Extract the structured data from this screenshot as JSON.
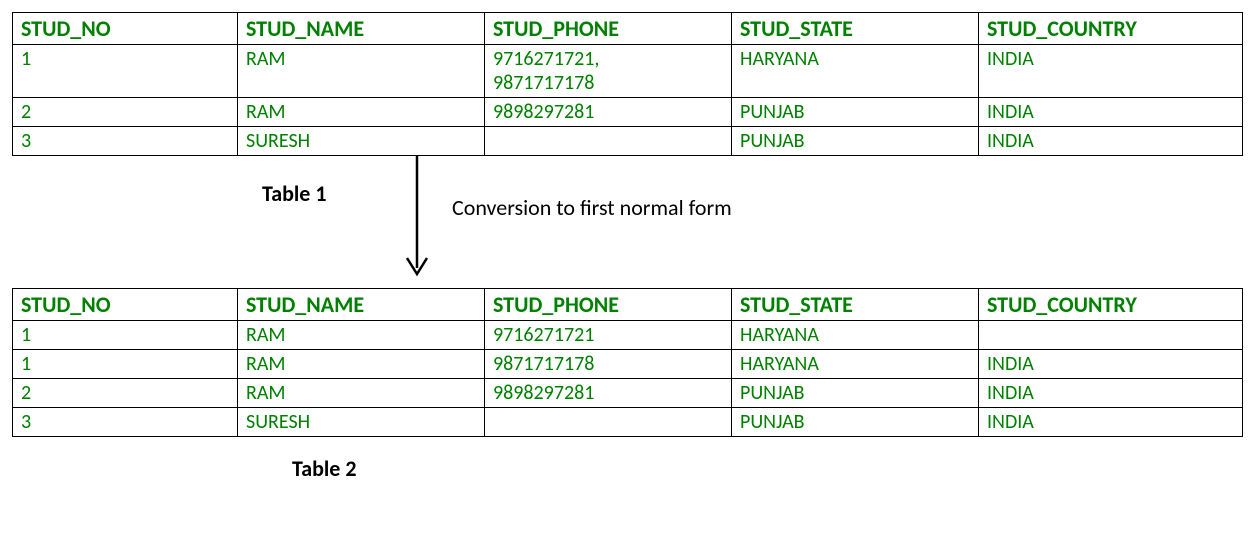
{
  "table1": {
    "headers": [
      "STUD_NO",
      "STUD_NAME",
      "STUD_PHONE",
      "STUD_STATE",
      "STUD_COUNTRY"
    ],
    "rows": [
      [
        "1",
        "RAM",
        "9716271721,\n9871717178",
        "HARYANA",
        "INDIA"
      ],
      [
        "2",
        "RAM",
        "9898297281",
        "PUNJAB",
        "INDIA"
      ],
      [
        "3",
        "SURESH",
        "",
        "PUNJAB",
        "INDIA"
      ]
    ],
    "caption": "Table 1"
  },
  "conversion_label": "Conversion to first normal form",
  "table2": {
    "headers": [
      "STUD_NO",
      "STUD_NAME",
      "STUD_PHONE",
      "STUD_STATE",
      "STUD_COUNTRY"
    ],
    "rows": [
      [
        "1",
        "RAM",
        "9716271721",
        "HARYANA",
        ""
      ],
      [
        "1",
        "RAM",
        "9871717178",
        "HARYANA",
        "INDIA"
      ],
      [
        "2",
        "RAM",
        "9898297281",
        "PUNJAB",
        "INDIA"
      ],
      [
        "3",
        "SURESH",
        "",
        "PUNJAB",
        "INDIA"
      ]
    ],
    "caption": "Table 2"
  },
  "chart_data": {
    "type": "table",
    "description": "Diagram showing conversion of a relation into First Normal Form (1NF) by splitting a multi-valued attribute (STUD_PHONE) into separate rows.",
    "before": {
      "name": "Table 1",
      "columns": [
        "STUD_NO",
        "STUD_NAME",
        "STUD_PHONE",
        "STUD_STATE",
        "STUD_COUNTRY"
      ],
      "rows": [
        {
          "STUD_NO": "1",
          "STUD_NAME": "RAM",
          "STUD_PHONE": "9716271721, 9871717178",
          "STUD_STATE": "HARYANA",
          "STUD_COUNTRY": "INDIA"
        },
        {
          "STUD_NO": "2",
          "STUD_NAME": "RAM",
          "STUD_PHONE": "9898297281",
          "STUD_STATE": "PUNJAB",
          "STUD_COUNTRY": "INDIA"
        },
        {
          "STUD_NO": "3",
          "STUD_NAME": "SURESH",
          "STUD_PHONE": "",
          "STUD_STATE": "PUNJAB",
          "STUD_COUNTRY": "INDIA"
        }
      ]
    },
    "arrow_label": "Conversion to first normal form",
    "after": {
      "name": "Table 2",
      "columns": [
        "STUD_NO",
        "STUD_NAME",
        "STUD_PHONE",
        "STUD_STATE",
        "STUD_COUNTRY"
      ],
      "rows": [
        {
          "STUD_NO": "1",
          "STUD_NAME": "RAM",
          "STUD_PHONE": "9716271721",
          "STUD_STATE": "HARYANA",
          "STUD_COUNTRY": ""
        },
        {
          "STUD_NO": "1",
          "STUD_NAME": "RAM",
          "STUD_PHONE": "9871717178",
          "STUD_STATE": "HARYANA",
          "STUD_COUNTRY": "INDIA"
        },
        {
          "STUD_NO": "2",
          "STUD_NAME": "RAM",
          "STUD_PHONE": "9898297281",
          "STUD_STATE": "PUNJAB",
          "STUD_COUNTRY": "INDIA"
        },
        {
          "STUD_NO": "3",
          "STUD_NAME": "SURESH",
          "STUD_PHONE": "",
          "STUD_STATE": "PUNJAB",
          "STUD_COUNTRY": "INDIA"
        }
      ]
    }
  }
}
